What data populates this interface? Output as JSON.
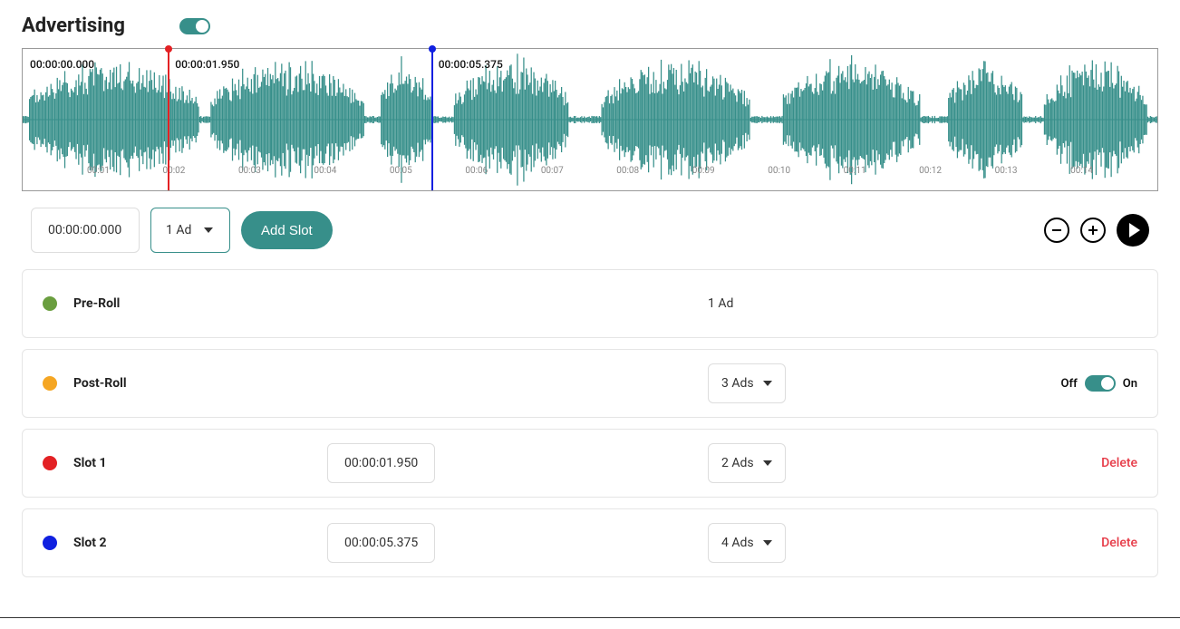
{
  "header": {
    "title": "Advertising",
    "toggle_on": true
  },
  "waveform": {
    "timestamps": {
      "start": "00:00:00.000",
      "marker1": "00:00:01.950",
      "marker2": "00:00:05.375"
    },
    "ticks": [
      "00:01",
      "00:02",
      "00:03",
      "00:04",
      "00:05",
      "00:06",
      "00:07",
      "00:08",
      "00:09",
      "00:10",
      "00:11",
      "00:12",
      "00:13",
      "00:14"
    ],
    "markers": [
      {
        "color": "#e32124",
        "position_pct": 12.8,
        "timestamp": "00:00:01.950"
      },
      {
        "color": "#1020e0",
        "position_pct": 36.0,
        "timestamp": "00:00:05.375"
      }
    ]
  },
  "controls": {
    "time_input": "00:00:00.000",
    "ads_select": "1 Ad",
    "add_slot_label": "Add Slot"
  },
  "slots": [
    {
      "color": "#6a9e3f",
      "name": "Pre-Roll",
      "ads_label": "1 Ad",
      "ads_has_caret": false,
      "has_time": false,
      "has_toggle": false,
      "has_delete": false
    },
    {
      "color": "#f5a623",
      "name": "Post-Roll",
      "ads_label": "3 Ads",
      "ads_has_caret": true,
      "has_time": false,
      "has_toggle": true,
      "toggle_off_label": "Off",
      "toggle_on_label": "On",
      "has_delete": false
    },
    {
      "color": "#e32124",
      "name": "Slot 1",
      "time": "00:00:01.950",
      "ads_label": "2 Ads",
      "ads_has_caret": true,
      "has_time": true,
      "has_toggle": false,
      "has_delete": true,
      "delete_label": "Delete"
    },
    {
      "color": "#1020e0",
      "name": "Slot 2",
      "time": "00:00:05.375",
      "ads_label": "4 Ads",
      "ads_has_caret": true,
      "has_time": true,
      "has_toggle": false,
      "has_delete": true,
      "delete_label": "Delete"
    }
  ]
}
